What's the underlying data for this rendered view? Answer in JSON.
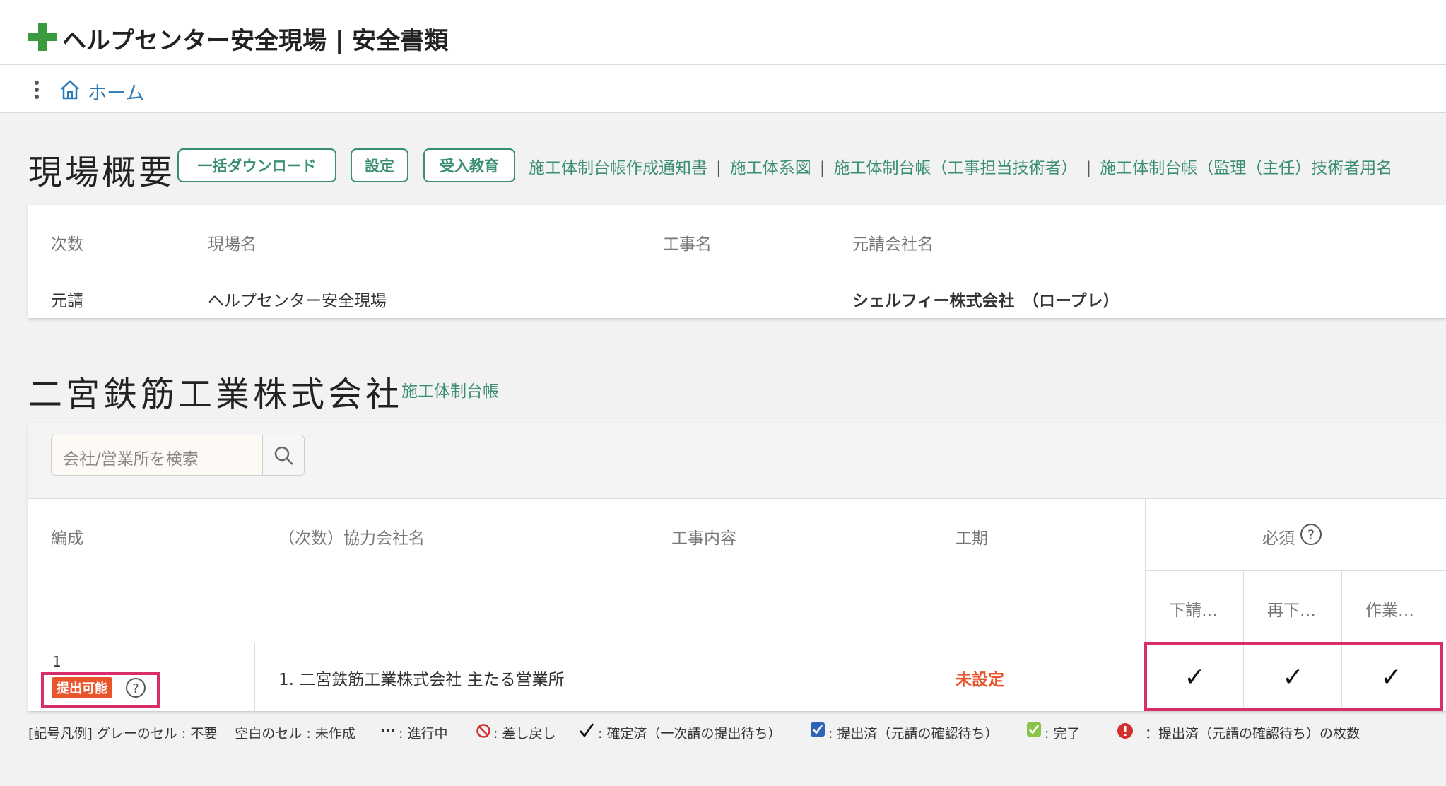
{
  "app": {
    "title": "ヘルプセンター安全現場 | 安全書類"
  },
  "breadcrumb": {
    "home": "ホーム"
  },
  "overview": {
    "heading": "現場概要",
    "buttons": {
      "download": "一括ダウンロード",
      "settings": "設定",
      "education": "受入教育"
    },
    "links": [
      "施工体制台帳作成通知書",
      "施工体系図",
      "施工体制台帳（工事担当技術者）",
      "施工体制台帳（監理（主任）技術者用名"
    ],
    "table": {
      "headers": [
        "次数",
        "現場名",
        "工事名",
        "元請会社名"
      ],
      "row": [
        "元請",
        "ヘルプセンター安全現場",
        "",
        "シェルフィー株式会社　（ロープレ）"
      ]
    }
  },
  "company": {
    "heading": "二宮鉄筋工業株式会社",
    "link": "施工体制台帳",
    "search": {
      "placeholder": "会社/営業所を検索"
    },
    "table": {
      "headers": {
        "formation": "編成",
        "partner": "（次数）協力会社名",
        "work": "工事内容",
        "period": "工期",
        "required": "必須"
      },
      "subheaders": [
        "下請…",
        "再下…",
        "作業…"
      ],
      "row": {
        "formation": "1",
        "badge": "提出可能",
        "partner": "1. 二宮鉄筋工業株式会社 主たる営業所",
        "work": "",
        "period": "未設定",
        "checks": [
          "✓",
          "✓",
          "✓"
        ]
      }
    }
  },
  "legend": {
    "prefix": "[記号凡例] グレーのセル : 不要　 空白のセル : 未作成",
    "inprogress_symbol": "···",
    "inprogress": ":  進行中",
    "rejected": ":  差し戻し",
    "confirmed": ":  確定済（一次請の提出待ち）",
    "submitted": ":  提出済（元請の確認待ち）",
    "complete": ":  完了",
    "count": "：提出済（元請の確認待ち）の枚数"
  },
  "colors": {
    "brand": "#3a8e73",
    "badge": "#e8552c",
    "highlight": "#d82d6b",
    "warning": "#e8552c"
  }
}
